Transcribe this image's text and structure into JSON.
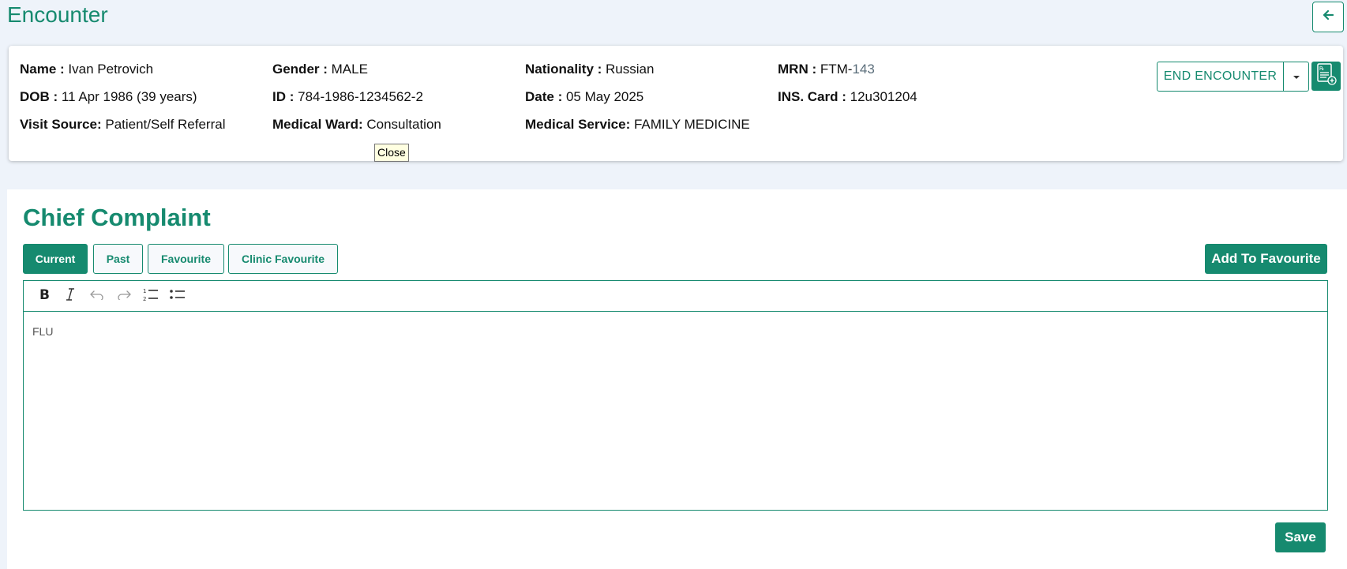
{
  "header": {
    "title": "Encounter",
    "back_icon": "arrow-left-icon"
  },
  "patient": {
    "name_label": "Name :",
    "name": "Ivan Petrovich",
    "gender_label": "Gender :",
    "gender": "MALE",
    "nationality_label": "Nationality :",
    "nationality": "Russian",
    "mrn_label": "MRN :",
    "mrn_prefix": "FTM-",
    "mrn_number": "143",
    "dob_label": "DOB :",
    "dob": "11 Apr 1986 (39 years)",
    "id_label": "ID :",
    "id": "784-1986-1234562-2",
    "date_label": "Date :",
    "date": "05 May 2025",
    "ins_label": "INS. Card :",
    "ins_card": "12u301204",
    "visit_source_label": "Visit Source:",
    "visit_source": "Patient/Self Referral",
    "ward_label": "Medical Ward:",
    "ward": "Consultation",
    "service_label": "Medical Service:",
    "service": "FAMILY MEDICINE"
  },
  "actions": {
    "end_encounter": "END ENCOUNTER",
    "prescription_icon": "prescription-icon"
  },
  "tooltip": {
    "text": "Close"
  },
  "chief_complaint": {
    "title": "Chief Complaint",
    "tabs": [
      {
        "label": "Current",
        "active": true
      },
      {
        "label": "Past",
        "active": false
      },
      {
        "label": "Favourite",
        "active": false
      },
      {
        "label": "Clinic Favourite",
        "active": false
      }
    ],
    "add_favourite": "Add To Favourite",
    "editor_content": "FLU",
    "save": "Save"
  },
  "colors": {
    "accent": "#168a6f",
    "background": "#eef3fa",
    "tooltip_bg": "#ffffe1"
  }
}
